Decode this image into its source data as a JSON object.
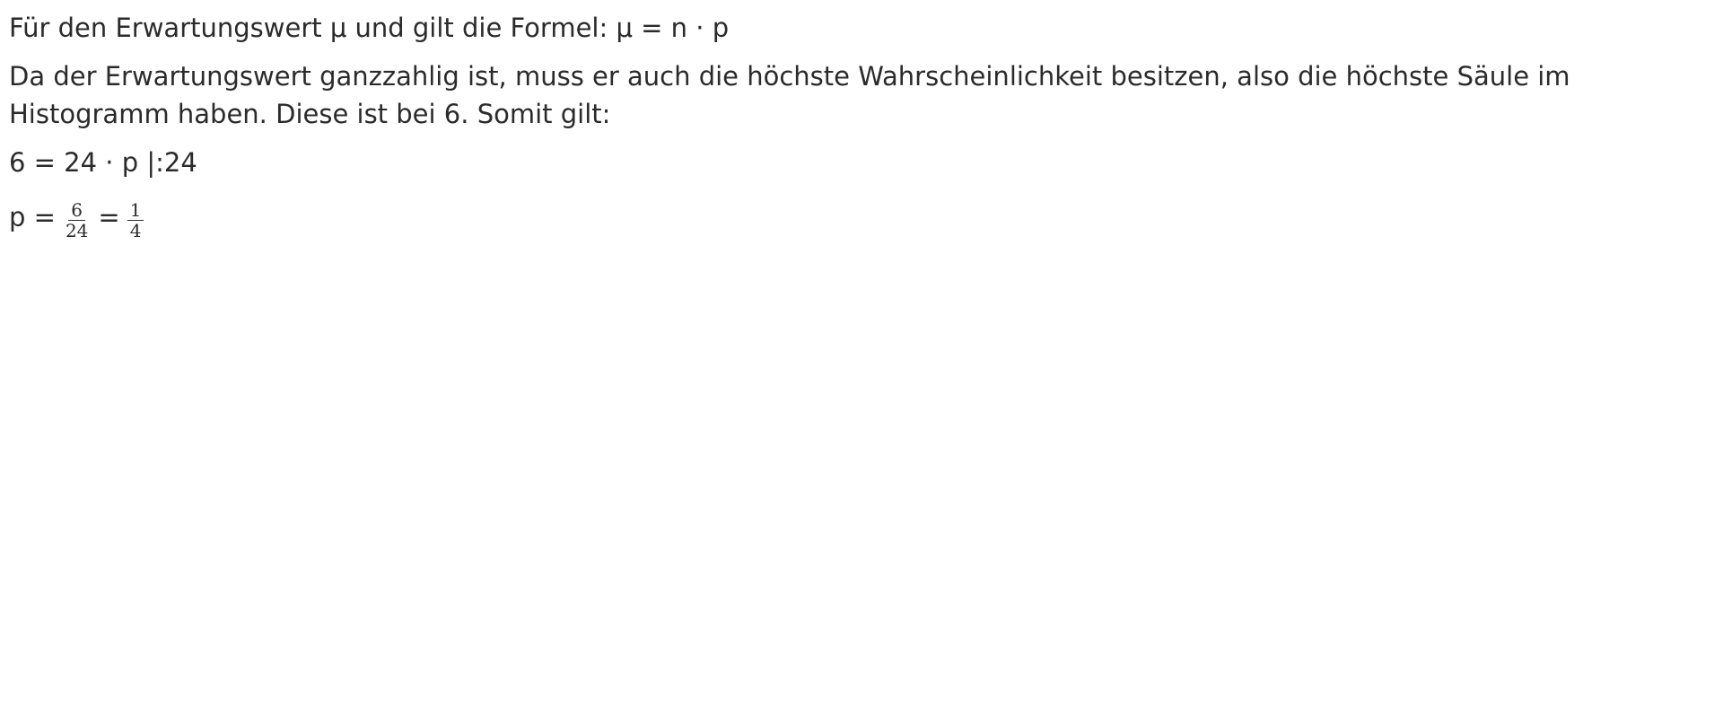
{
  "document": {
    "line1": "Für den Erwartungswert μ und gilt die Formel: μ = n · p",
    "paragraph2": "Da der Erwartungswert ganzzahlig ist, muss er auch die höchste Wahrscheinlichkeit besitzen, also die höchste Säule im Histogramm haben. Diese ist bei 6. Somit gilt:",
    "equation1": "6 = 24 · p |:24",
    "equation2": {
      "lhs": "p =",
      "frac1_num": "6",
      "frac1_den": "24",
      "eq": "=",
      "frac2_num": "1",
      "frac2_den": "4"
    }
  }
}
